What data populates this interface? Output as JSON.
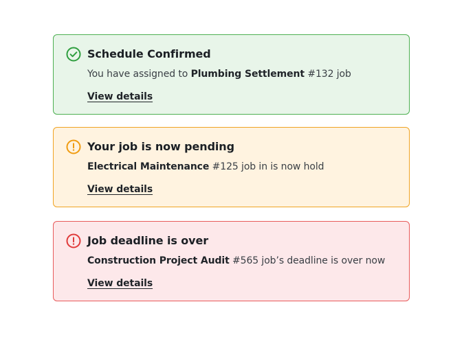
{
  "alerts": [
    {
      "type": "success",
      "icon": "check-circle-icon",
      "color": "#2e9e3e",
      "title": "Schedule Confirmed",
      "message_prefix": "You have assigned to ",
      "message_bold": "Plumbing Settlement",
      "message_suffix": " #132 job",
      "link": "View details"
    },
    {
      "type": "warning",
      "icon": "exclamation-circle-icon",
      "color": "#f09b10",
      "title": "Your job is now pending",
      "message_prefix": "",
      "message_bold": "Electrical Maintenance",
      "message_suffix": " #125 job in is now hold",
      "link": "View details"
    },
    {
      "type": "danger",
      "icon": "exclamation-circle-icon",
      "color": "#e03a3a",
      "title": "Job deadline is over",
      "message_prefix": "",
      "message_bold": "Construction Project Audit",
      "message_suffix": " #565 job’s deadline is over now",
      "link": "View details"
    }
  ]
}
